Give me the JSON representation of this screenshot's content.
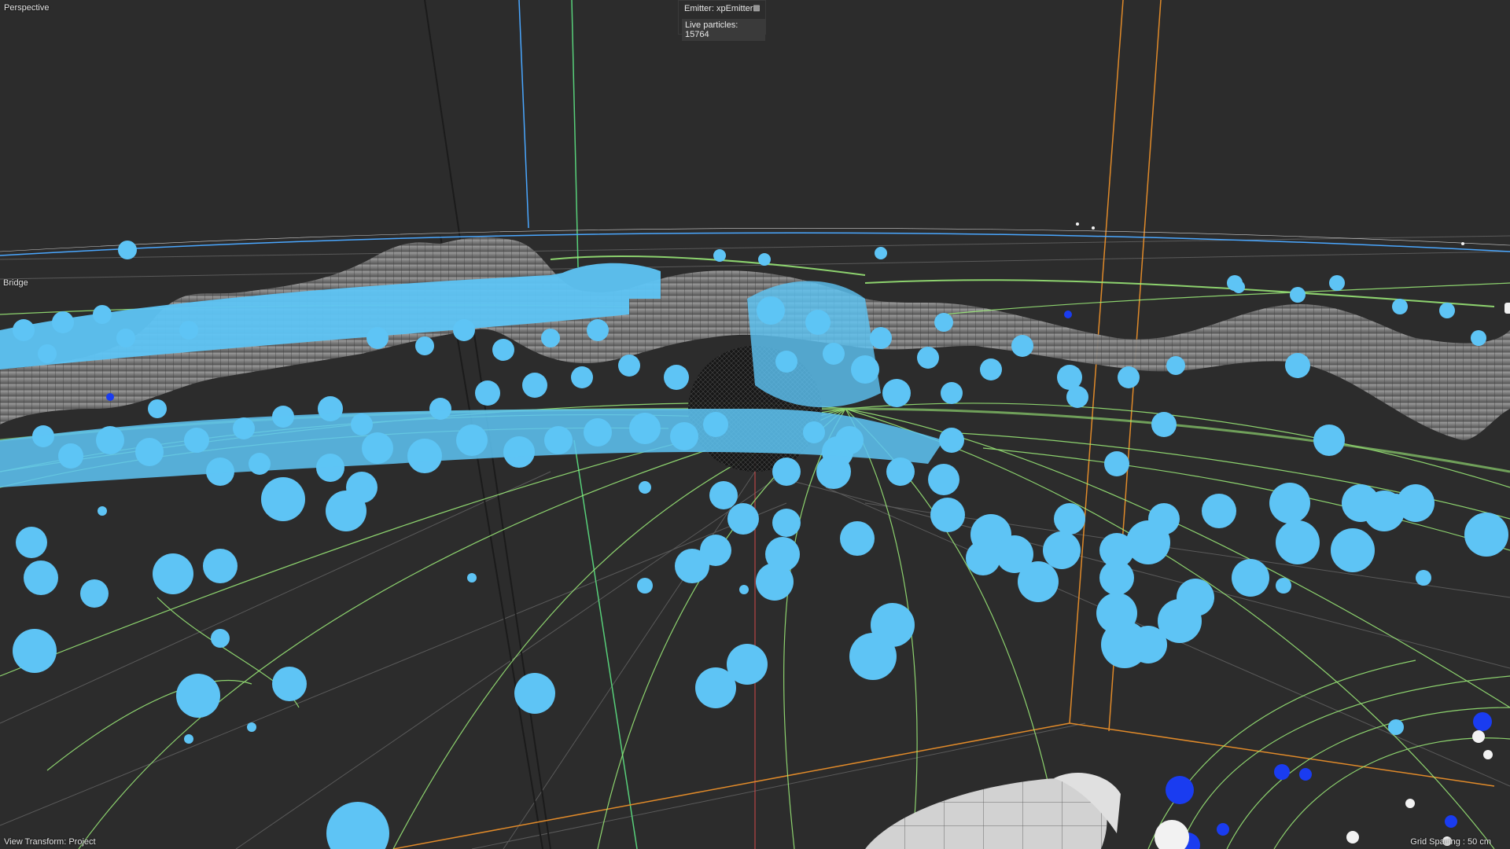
{
  "viewport": {
    "view_name": "Perspective",
    "object_label": "Bridge",
    "view_transform": "View Transform: Project",
    "grid_spacing": "Grid Spacing : 50 cm"
  },
  "emitter_info": {
    "emitter_name": "Emitter: xpEmitter",
    "icon": "camera-icon",
    "live_particles": "Live particles: 15764"
  },
  "colors": {
    "background": "#2c2c2c",
    "particles": "#5ec4f5",
    "particles_dark": "#1a3cf0",
    "trails": "#9ef07a",
    "bounds": "#e08a2a",
    "mesh": "#8e8e8e",
    "horizon_line": "#4aa7ff"
  }
}
